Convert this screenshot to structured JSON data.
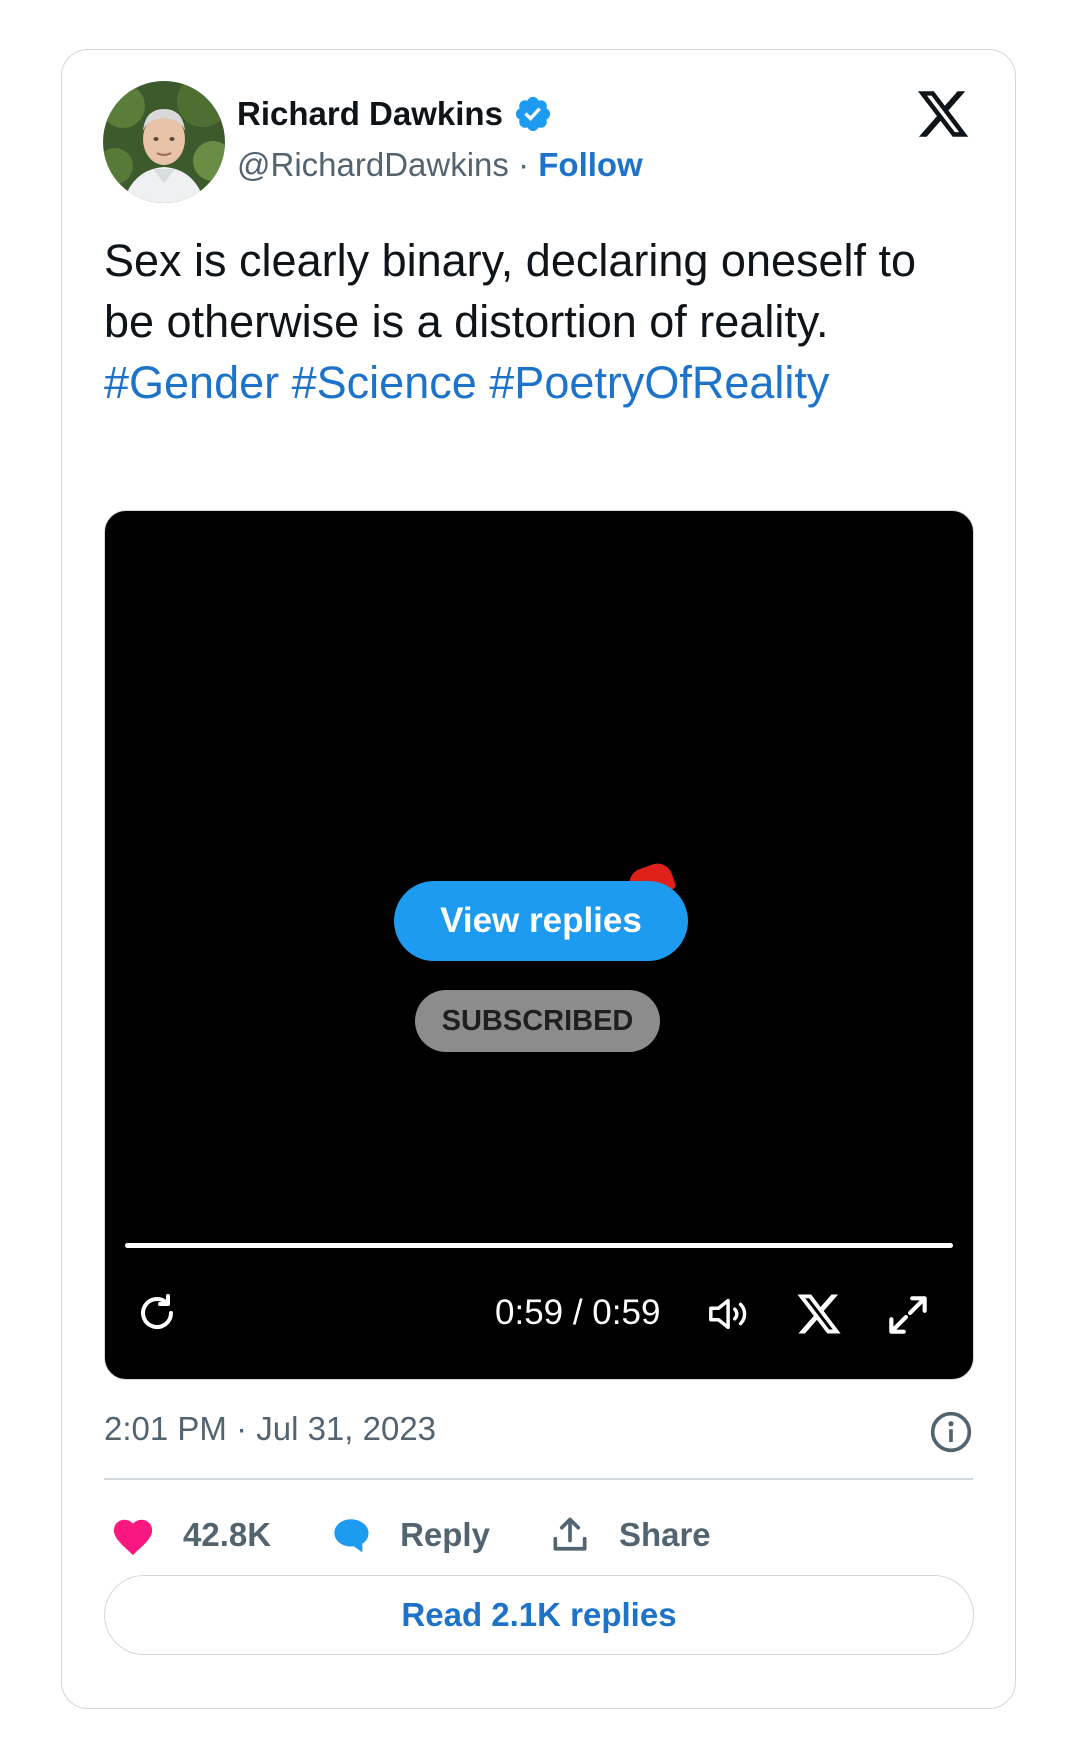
{
  "author": {
    "name": "Richard Dawkins",
    "handle": "@RichardDawkins",
    "separator": " · ",
    "follow_label": "Follow",
    "verified": true
  },
  "tweet": {
    "text": "Sex is clearly binary, declaring oneself to be otherwise is a distortion of reality. ",
    "hashtags": [
      "#Gender",
      "#Science",
      "#PoetryOfReality"
    ],
    "timestamp": "2:01 PM · Jul 31, 2023"
  },
  "video": {
    "view_replies_label": "View replies",
    "subscribed_label": "SUBSCRIBED",
    "time_display": "0:59 / 0:59",
    "progress_fraction": 1.0
  },
  "actions": {
    "likes": "42.8K",
    "reply_label": "Reply",
    "share_label": "Share"
  },
  "read_replies_label": "Read 2.1K replies",
  "colors": {
    "link": "#1d73c9",
    "accent": "#1d9bf0",
    "like": "#f91880",
    "muted": "#536471",
    "border": "#cfd9de"
  },
  "icons": [
    "verified-badge-icon",
    "x-logo-icon",
    "replay-icon",
    "volume-icon",
    "fullscreen-icon",
    "info-icon",
    "heart-icon",
    "reply-bubble-icon",
    "share-icon"
  ]
}
